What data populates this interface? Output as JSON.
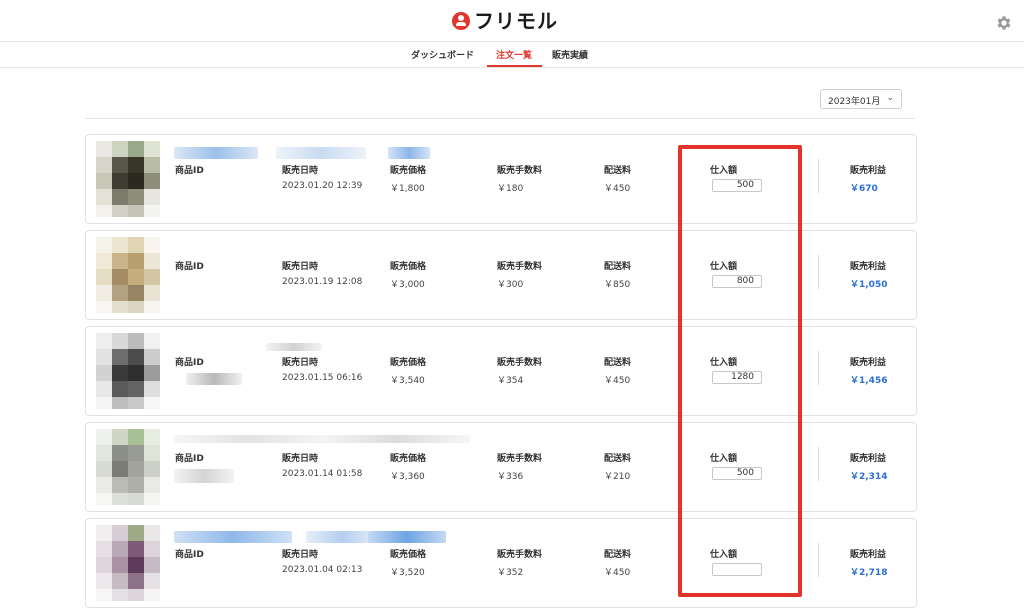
{
  "app": {
    "logo_text": "フリモル",
    "accent_color": "#e2352c",
    "profit_color": "#2a6fd1"
  },
  "header": {
    "settings_icon": "gear-icon"
  },
  "nav": {
    "tabs": [
      {
        "label": "ダッシュボード"
      },
      {
        "label": "注文一覧",
        "active": true
      },
      {
        "label": "販売実績"
      }
    ]
  },
  "filter": {
    "month": "2023年01月"
  },
  "columns": {
    "item_id": "商品ID",
    "sale_date": "販売日時",
    "sale_price": "販売価格",
    "fee": "販売手数料",
    "shipping": "配送料",
    "cost": "仕入額",
    "profit": "販売利益"
  },
  "orders": [
    {
      "date": "2023.01.20 12:39",
      "price": "￥1,800",
      "fee": "￥180",
      "shipping": "￥450",
      "cost": "500",
      "profit": "￥670"
    },
    {
      "date": "2023.01.19 12:08",
      "price": "￥3,000",
      "fee": "￥300",
      "shipping": "￥850",
      "cost": "800",
      "profit": "￥1,050"
    },
    {
      "date": "2023.01.15 06:16",
      "price": "￥3,540",
      "fee": "￥354",
      "shipping": "￥450",
      "cost": "1280",
      "profit": "￥1,456"
    },
    {
      "date": "2023.01.14 01:58",
      "price": "￥3,360",
      "fee": "￥336",
      "shipping": "￥210",
      "cost": "500",
      "profit": "￥2,314"
    },
    {
      "date": "2023.01.04 02:13",
      "price": "￥3,520",
      "fee": "￥352",
      "shipping": "￥450",
      "cost": "",
      "profit": "￥2,718"
    }
  ]
}
